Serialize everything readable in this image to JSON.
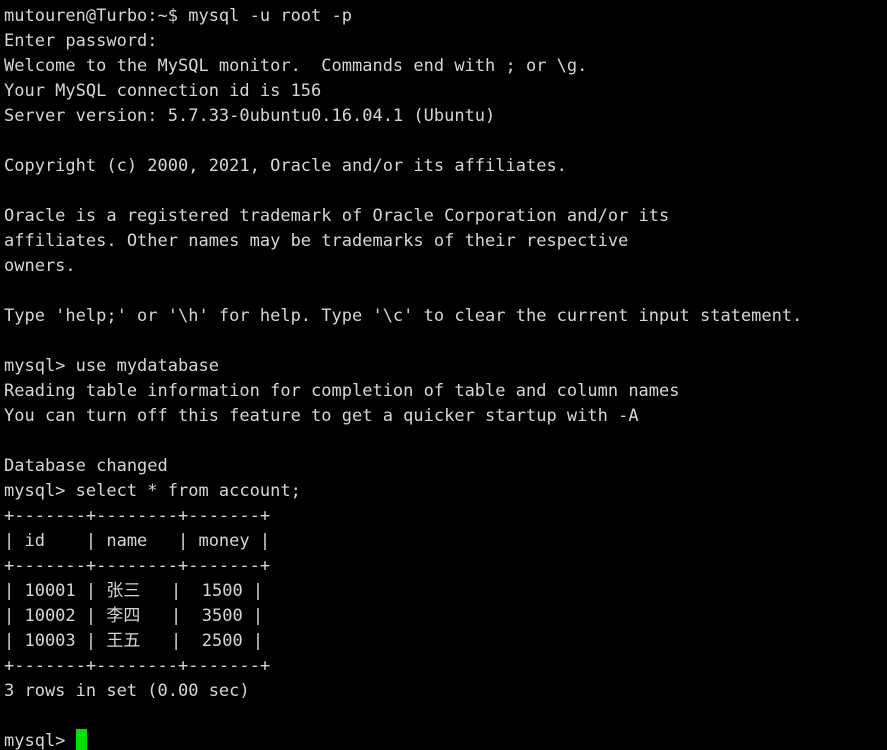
{
  "terminal": {
    "colors": {
      "background": "#000000",
      "foreground": "#d6d6d6",
      "cursor": "#00e000"
    },
    "shell_prompt": "mutouren@Turbo:~$",
    "mysql_prompt": "mysql>",
    "lines": [
      "mutouren@Turbo:~$ mysql -u root -p",
      "Enter password:",
      "Welcome to the MySQL monitor.  Commands end with ; or \\g.",
      "Your MySQL connection id is 156",
      "Server version: 5.7.33-0ubuntu0.16.04.1 (Ubuntu)",
      "",
      "Copyright (c) 2000, 2021, Oracle and/or its affiliates.",
      "",
      "Oracle is a registered trademark of Oracle Corporation and/or its",
      "affiliates. Other names may be trademarks of their respective",
      "owners.",
      "",
      "Type 'help;' or '\\h' for help. Type '\\c' to clear the current input statement.",
      "",
      "mysql> use mydatabase",
      "Reading table information for completion of table and column names",
      "You can turn off this feature to get a quicker startup with -A",
      "",
      "Database changed",
      "mysql> select * from account;",
      "+-------+--------+-------+",
      "| id    | name   | money |",
      "+-------+--------+-------+",
      "| 10001 | 张三   |  1500 |",
      "| 10002 | 李四   |  3500 |",
      "| 10003 | 王五   |  2500 |",
      "+-------+--------+-------+",
      "3 rows in set (0.00 sec)",
      ""
    ],
    "final_prompt": "mysql> ",
    "commands": [
      "mysql -u root -p",
      "use mydatabase",
      "select * from account;"
    ],
    "session": {
      "user": "mutouren",
      "host": "Turbo",
      "cwd": "~",
      "connection_id": "156",
      "server_version": "5.7.33-0ubuntu0.16.04.1 (Ubuntu)",
      "database": "mydatabase",
      "password_prompt": "Enter password:",
      "database_changed": "Database changed",
      "result_summary": "3 rows in set (0.00 sec)"
    },
    "result_table": {
      "columns": [
        "id",
        "name",
        "money"
      ],
      "rows": [
        [
          "10001",
          "张三",
          "1500"
        ],
        [
          "10002",
          "李四",
          "3500"
        ],
        [
          "10003",
          "王五",
          "2500"
        ]
      ],
      "row_count": 3,
      "elapsed": "0.00 sec",
      "separator": "+-------+--------+-------+"
    }
  }
}
